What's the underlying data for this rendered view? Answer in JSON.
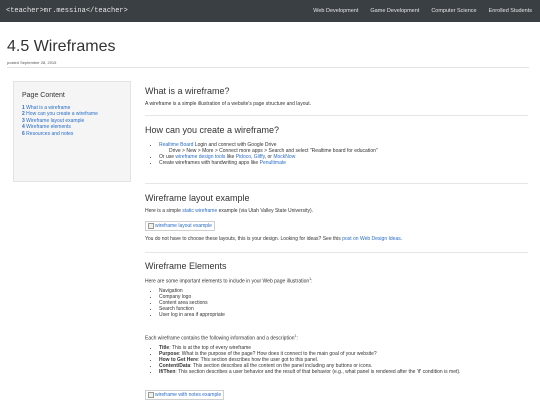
{
  "nav": {
    "brand": "<teacher>mr.messina</teacher>",
    "links": [
      "Web Development",
      "Game Development",
      "Computer Science",
      "Enrolled Students"
    ]
  },
  "page": {
    "title": "4.5 Wireframes",
    "posted": "posted September 28, 2015"
  },
  "toc": {
    "title": "Page Content",
    "items": [
      {
        "num": "1",
        "label": "What is a wireframe"
      },
      {
        "num": "2",
        "label": "How can you create a wireframe"
      },
      {
        "num": "3",
        "label": "Wireframe layout example"
      },
      {
        "num": "4",
        "label": "Wireframe elements"
      },
      {
        "num": "6",
        "label": "Resources and notes"
      }
    ]
  },
  "s1": {
    "heading": "What is a wireframe?",
    "text": "A wireframe is a simple illustration of a website's page structure and layout."
  },
  "s2": {
    "heading": "How can you create a wireframe?",
    "b1_link": "Realtime Board",
    "b1_text": " Login and connect with Google Drive",
    "b1_sub": "Drive > New > More > Connect more apps > Search and select \"Realtime board for education\"",
    "b2_pre": "Or use ",
    "b2_link1": "wireframe design tools",
    "b2_mid": " like ",
    "b2_link2": "Pidoco",
    "b2_sep1": ", ",
    "b2_link3": "Gliffy",
    "b2_sep2": ", or ",
    "b2_link4": "MockNow",
    "b3_pre": "Create wireframes with handwriting apps like ",
    "b3_link": "Penultimate"
  },
  "s3": {
    "heading": "Wireframe layout example",
    "p1_pre": "Here is a simple ",
    "p1_link": "static wireframe",
    "p1_post": " example (via Utah Valley State University).",
    "img_alt": "wireframe layout example",
    "p2_pre": "You do not have to choose these layouts, this is your design. Looking for ideas? See this ",
    "p2_link": "post on Web Design Ideas",
    "p2_post": "."
  },
  "s4": {
    "heading": "Wireframe Elements",
    "intro": "Here are some important elements to include in your Web page illustration",
    "intro_sup": "1",
    "intro_end": ":",
    "items": [
      "Navigation",
      "Company logo",
      "Content area sections",
      "Search function",
      "User log in area if appropriate"
    ],
    "intro2": "Each wireframe contains the following information and a description",
    "intro2_sup": "1",
    "intro2_end": ":",
    "defs": [
      {
        "term": "Title",
        "desc": ": This is at the top of every wireframe"
      },
      {
        "term": "Purpose",
        "desc": ": What is the purpose of the page? How does it connect to the main goal of your website?"
      },
      {
        "term": "How to Get Here",
        "desc": ": This section describes how the user got to this panel."
      },
      {
        "term": "Content/Data",
        "desc": ": This section describes all the content on the panel including any buttons or icons."
      },
      {
        "term": "If/Then",
        "desc": ": This section describes a user behavior and the result of that behavior (e.g., what panel is rendered after the 'if' condition is met)."
      }
    ],
    "img_alt": "wireframe with notes example"
  }
}
